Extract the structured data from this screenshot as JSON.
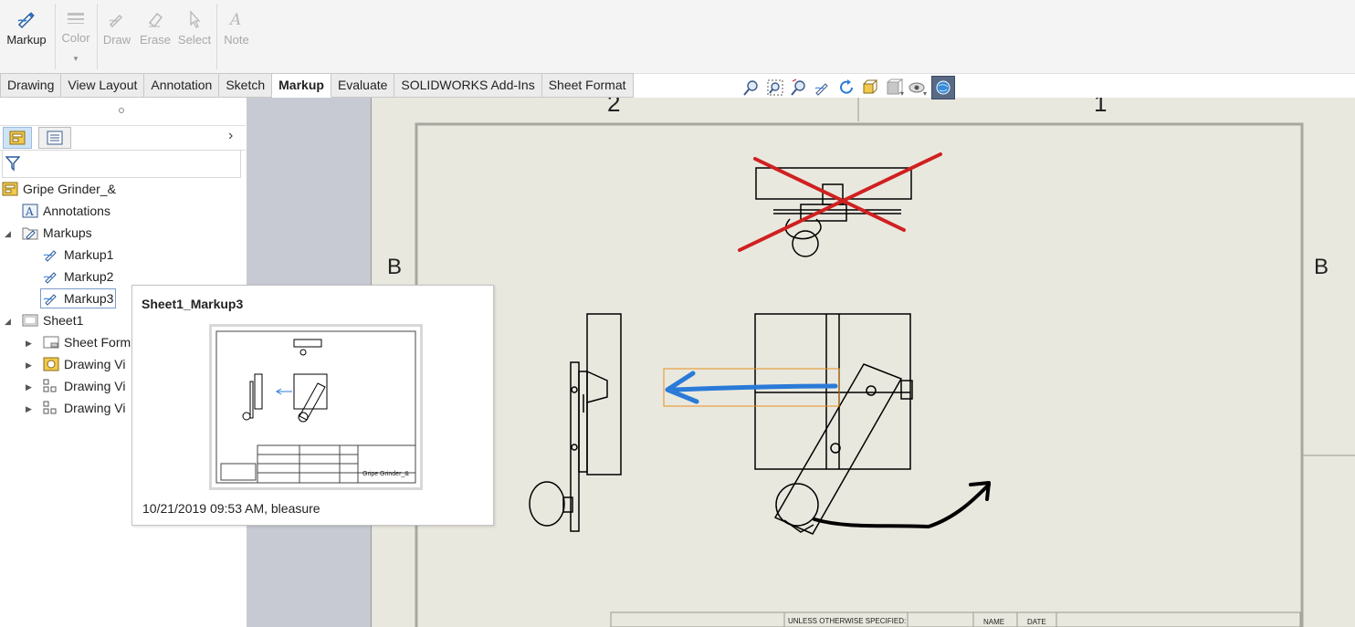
{
  "ribbon": {
    "markup": "Markup",
    "color": "Color",
    "draw": "Draw",
    "erase": "Erase",
    "select": "Select",
    "note": "Note"
  },
  "tabs": [
    "Drawing",
    "View Layout",
    "Annotation",
    "Sketch",
    "Markup",
    "Evaluate",
    "SOLIDWORKS Add-Ins",
    "Sheet Format"
  ],
  "active_tab": "Markup",
  "tree": {
    "root": "Gripe Grinder_&",
    "annotations": "Annotations",
    "markups": "Markups",
    "markup1": "Markup1",
    "markup2": "Markup2",
    "markup3": "Markup3",
    "sheet1": "Sheet1",
    "sheet_format": "Sheet Form",
    "drawing_view1": "Drawing Vi",
    "drawing_view2": "Drawing Vi",
    "drawing_view3": "Drawing Vi"
  },
  "tooltip": {
    "title": "Sheet1_Markup3",
    "date": "10/21/2019 09:53 AM, bleasure",
    "thumb_caption": "Gripe Grinder_&"
  },
  "sheet": {
    "zone_top_left": "2",
    "zone_top_right": "1",
    "zone_row_left": "B",
    "zone_row_right": "B",
    "title_unless": "UNLESS OTHERWISE SPECIFIED:",
    "title_name": "NAME",
    "title_date": "DATE"
  },
  "colors": {
    "cross": "#d02020",
    "arrow_blue": "#2a7ad8",
    "highlight_orange": "#e89020",
    "sheet_bg": "#e9e8df",
    "gfx_bg": "#c8cad3"
  }
}
